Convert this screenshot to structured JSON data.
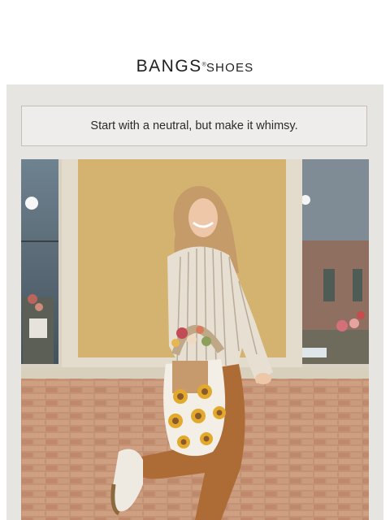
{
  "logo": {
    "brand": "BANGS",
    "mark": "®",
    "sub": "SHOES"
  },
  "banner": {
    "tagline": "Start with a neutral, but make it whimsy."
  },
  "hero": {
    "alt": "Woman in a striped jacket and rust pants posing with a crochet sunflower tote bag in front of a brick storefront"
  },
  "colors": {
    "panel": "#e7e5e2",
    "tagline_border": "#c7bfb5",
    "text": "#2b2b2b",
    "wall": "#d1b06a",
    "brick": "#c69577",
    "pants": "#b0703a"
  }
}
